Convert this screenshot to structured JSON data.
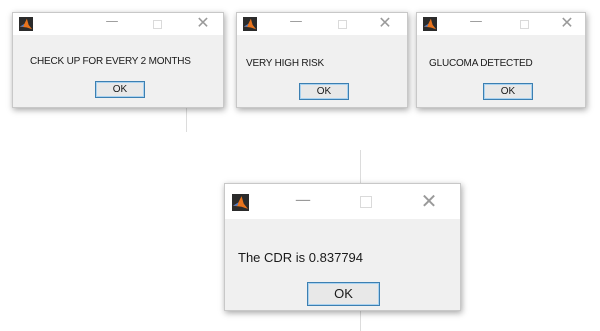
{
  "dialogs": [
    {
      "message": "CHECK UP FOR EVERY 2 MONTHS",
      "ok_label": "OK",
      "min_glyph": "—",
      "close_glyph": "✕"
    },
    {
      "message": "VERY HIGH RISK",
      "ok_label": "OK",
      "min_glyph": "—",
      "close_glyph": "✕"
    },
    {
      "message": "GLUCOMA DETECTED",
      "ok_label": "OK",
      "min_glyph": "—",
      "close_glyph": "✕"
    },
    {
      "message": "The CDR is 0.837794",
      "ok_label": "OK",
      "min_glyph": "—",
      "close_glyph": "✕"
    }
  ],
  "icons": {
    "app": "matlab-icon",
    "minimize": "minimize-icon",
    "maximize": "maximize-icon",
    "close": "close-icon"
  },
  "colors": {
    "dialog_bg": "#f0f0f0",
    "titlebar_bg": "#ffffff",
    "button_border": "#3c7fb1",
    "matlab_orange": "#e8731c"
  }
}
